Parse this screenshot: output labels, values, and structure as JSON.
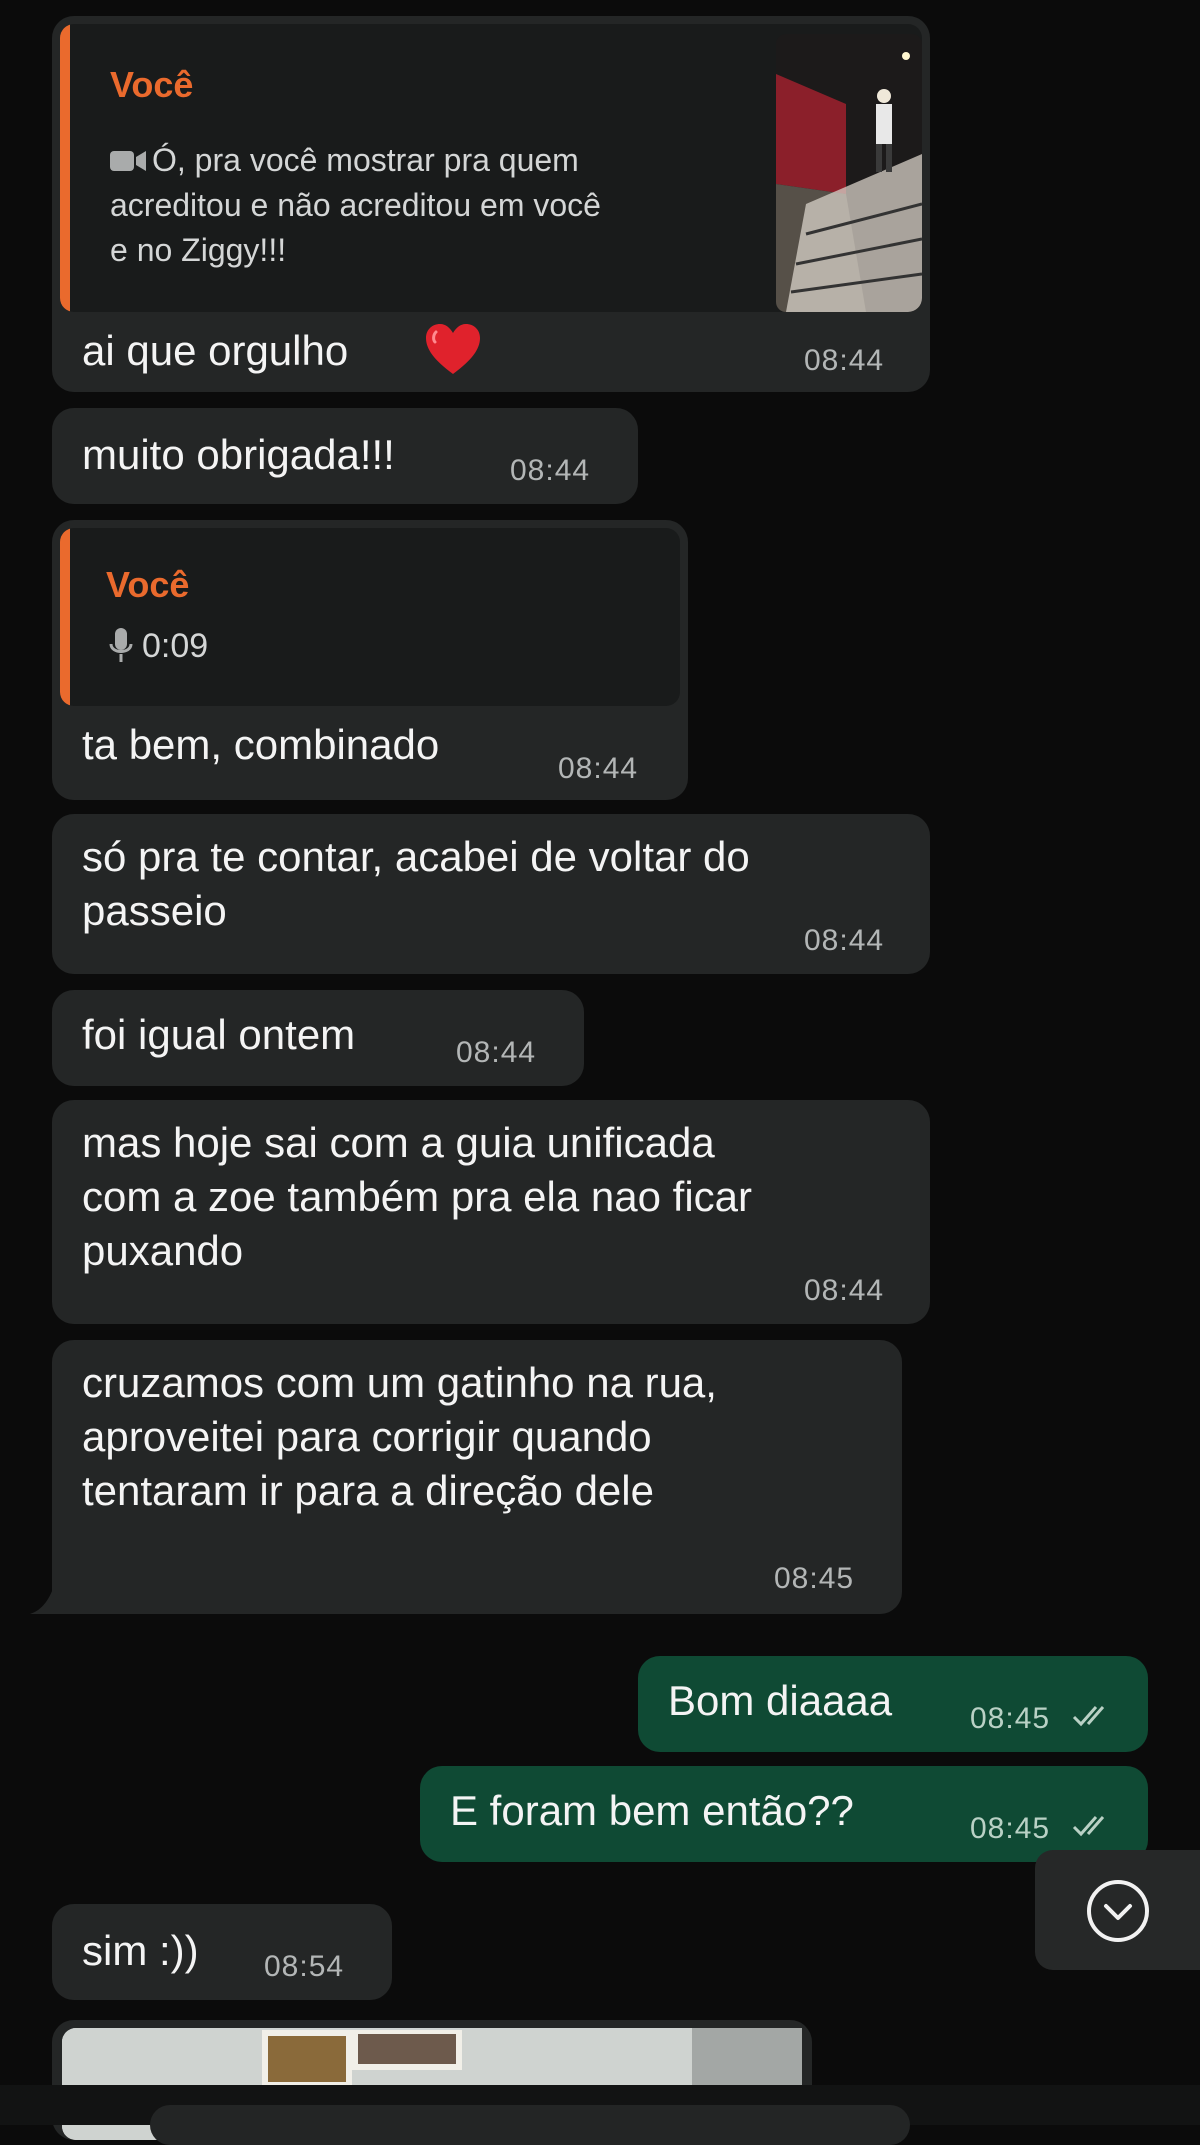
{
  "messages": [
    {
      "id": "m1",
      "direction": "incoming",
      "reply": {
        "author": "Você",
        "type": "video",
        "icon": "video-icon",
        "text": "Ó, pra você mostrar pra quem acreditou e não acreditou em você e no Ziggy!!!"
      },
      "text": "ai que orgulho",
      "emoji": "heart-icon",
      "time": "08:44"
    },
    {
      "id": "m2",
      "direction": "incoming",
      "text": "muito obrigada!!!",
      "time": "08:44"
    },
    {
      "id": "m3",
      "direction": "incoming",
      "reply": {
        "author": "Você",
        "type": "audio",
        "icon": "microphone-icon",
        "duration": "0:09"
      },
      "text": "ta bem, combinado",
      "time": "08:44"
    },
    {
      "id": "m4",
      "direction": "incoming",
      "text": "só pra te contar, acabei de voltar do passeio",
      "time": "08:44"
    },
    {
      "id": "m5",
      "direction": "incoming",
      "text": "foi igual ontem",
      "time": "08:44"
    },
    {
      "id": "m6",
      "direction": "incoming",
      "text": "mas hoje sai com a guia unificada com a zoe também pra ela nao ficar puxando",
      "time": "08:44"
    },
    {
      "id": "m7",
      "direction": "incoming",
      "text": "cruzamos com um gatinho na rua, aproveitei para corrigir quando tentaram ir para a direção dele",
      "time": "08:45"
    },
    {
      "id": "m8",
      "direction": "outgoing",
      "text": "Bom diaaaa",
      "time": "08:45",
      "status": "read"
    },
    {
      "id": "m9",
      "direction": "outgoing",
      "text": "E foram bem então??",
      "time": "08:45",
      "status": "read"
    },
    {
      "id": "m10",
      "direction": "incoming",
      "text": "sim :))",
      "time": "08:54"
    }
  ],
  "lines": {
    "m1_reply": "Ó, pra você mostrar pra quem\nacreditou e não acreditou em você\ne no Ziggy!!!",
    "m4": "só pra te contar, acabei de voltar do\npasseio",
    "m6": "mas hoje sai com a guia unificada\ncom a zoe também pra ela nao ficar\npuxando",
    "m7": "cruzamos com um gatinho na rua,\naproveitei para corrigir quando\ntentaram ir para a direção dele"
  },
  "scroll_button_icon": "chevron-down-icon",
  "colors": {
    "background": "#0b0b0b",
    "incoming_bubble": "#242626",
    "outgoing_bubble": "#0f4a34",
    "reply_accent": "#ea6a2d",
    "read_ticks": "#b9d1c5"
  }
}
